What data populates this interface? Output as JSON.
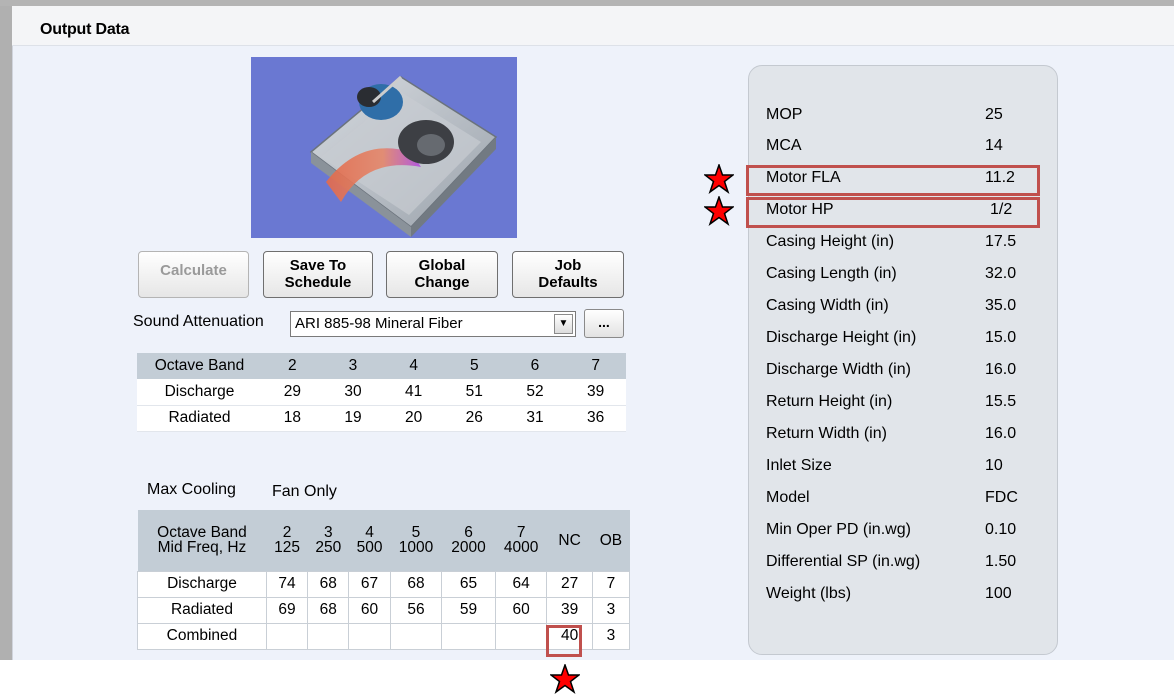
{
  "title": "Output Data",
  "buttons": {
    "calculate": "Calculate",
    "save_to_schedule": [
      "Save To",
      "Schedule"
    ],
    "global_change": [
      "Global",
      "Change"
    ],
    "job_defaults": [
      "Job",
      "Defaults"
    ]
  },
  "sound_attenuation": {
    "label": "Sound Attenuation",
    "selected": "ARI 885-98 Mineral Fiber",
    "more_button": "..."
  },
  "octave_table": {
    "header_label": "Octave Band",
    "bands": [
      "2",
      "3",
      "4",
      "5",
      "6",
      "7"
    ],
    "rows": [
      {
        "label": "Discharge",
        "values": [
          "29",
          "30",
          "41",
          "51",
          "52",
          "39"
        ]
      },
      {
        "label": "Radiated",
        "values": [
          "18",
          "19",
          "20",
          "26",
          "31",
          "36"
        ]
      }
    ]
  },
  "max_cooling": {
    "label": "Max Cooling",
    "value": "Fan Only"
  },
  "nc_table": {
    "header_label_1": "Octave Band",
    "header_label_2": "Mid Freq, Hz",
    "bands": [
      {
        "band": "2",
        "freq": "125"
      },
      {
        "band": "3",
        "freq": "250"
      },
      {
        "band": "4",
        "freq": "500"
      },
      {
        "band": "5",
        "freq": "1000"
      },
      {
        "band": "6",
        "freq": "2000"
      },
      {
        "band": "7",
        "freq": "4000"
      }
    ],
    "nc_label": "NC",
    "ob_label": "OB",
    "rows": [
      {
        "label": "Discharge",
        "values": [
          "74",
          "68",
          "67",
          "68",
          "65",
          "64"
        ],
        "nc": "27",
        "ob": "7"
      },
      {
        "label": "Radiated",
        "values": [
          "69",
          "68",
          "60",
          "56",
          "59",
          "60"
        ],
        "nc": "39",
        "ob": "3"
      },
      {
        "label": "Combined",
        "values": [
          "",
          "",
          "",
          "",
          "",
          ""
        ],
        "nc": "40",
        "ob": "3"
      }
    ]
  },
  "properties": [
    {
      "label": "MOP",
      "value": "25"
    },
    {
      "label": "MCA",
      "value": "14"
    },
    {
      "label": "Motor FLA",
      "value": "11.2"
    },
    {
      "label": "Motor HP",
      "value": "1/2"
    },
    {
      "label": "Casing Height (in)",
      "value": "17.5"
    },
    {
      "label": "Casing Length (in)",
      "value": "32.0"
    },
    {
      "label": "Casing Width (in)",
      "value": "35.0"
    },
    {
      "label": "Discharge Height (in)",
      "value": "15.0"
    },
    {
      "label": "Discharge Width (in)",
      "value": "16.0"
    },
    {
      "label": "Return Height (in)",
      "value": "15.5"
    },
    {
      "label": "Return Width (in)",
      "value": "16.0"
    },
    {
      "label": "Inlet Size",
      "value": "10"
    },
    {
      "label": "Model",
      "value": "FDC"
    },
    {
      "label": "Min Oper PD (in.wg)",
      "value": "0.10"
    },
    {
      "label": "Differential SP (in.wg)",
      "value": "1.50"
    },
    {
      "label": "Weight (lbs)",
      "value": "100"
    }
  ],
  "colors": {
    "highlight": "#c0504d",
    "star": "#ff0000"
  }
}
